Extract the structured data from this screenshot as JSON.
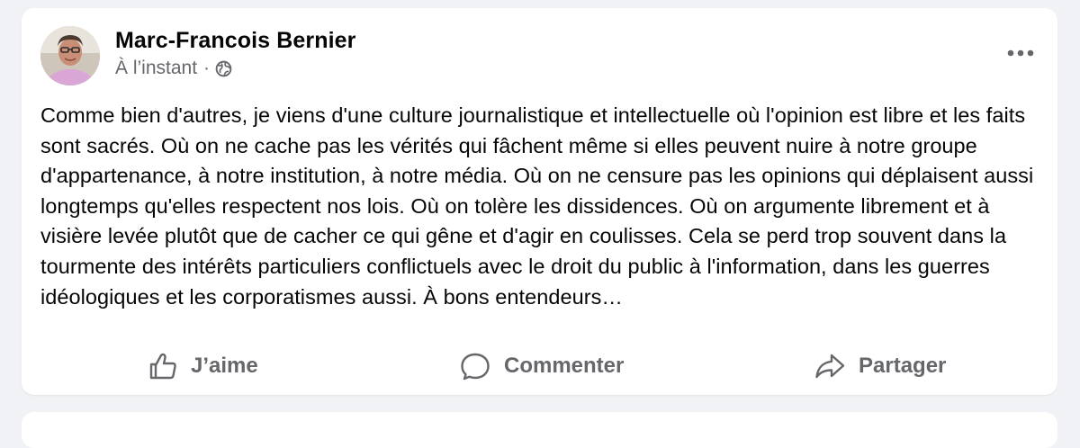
{
  "post": {
    "author": "Marc-Francois Bernier",
    "timestamp": "À l’instant",
    "separator": "·",
    "audience_icon": "globe-icon",
    "more_icon": "more-horizontal-icon",
    "text": "Comme bien d'autres, je viens d'une culture journalistique et intellectuelle où l'opinion est libre et les faits sont sacrés. Où on ne cache pas les vérités qui fâchent même si elles peuvent nuire à notre groupe d'appartenance, à notre institution, à notre média. Où on ne censure pas les opinions qui déplaisent aussi longtemps qu'elles respectent nos lois. Où on tolère les dissidences. Où on argumente librement et à visière levée plutôt que de cacher ce qui gêne et d'agir en coulisses. Cela se perd trop souvent dans la tourmente des intérêts particuliers conflictuels avec le droit du public à l'information, dans les guerres idéologiques et les corporatismes aussi. À bons entendeurs…"
  },
  "actions": {
    "like_label": "J’aime",
    "comment_label": "Commenter",
    "share_label": "Partager"
  },
  "colors": {
    "background": "#f0f2f5",
    "card": "#ffffff",
    "primary_text": "#050505",
    "secondary_text": "#65676b"
  }
}
